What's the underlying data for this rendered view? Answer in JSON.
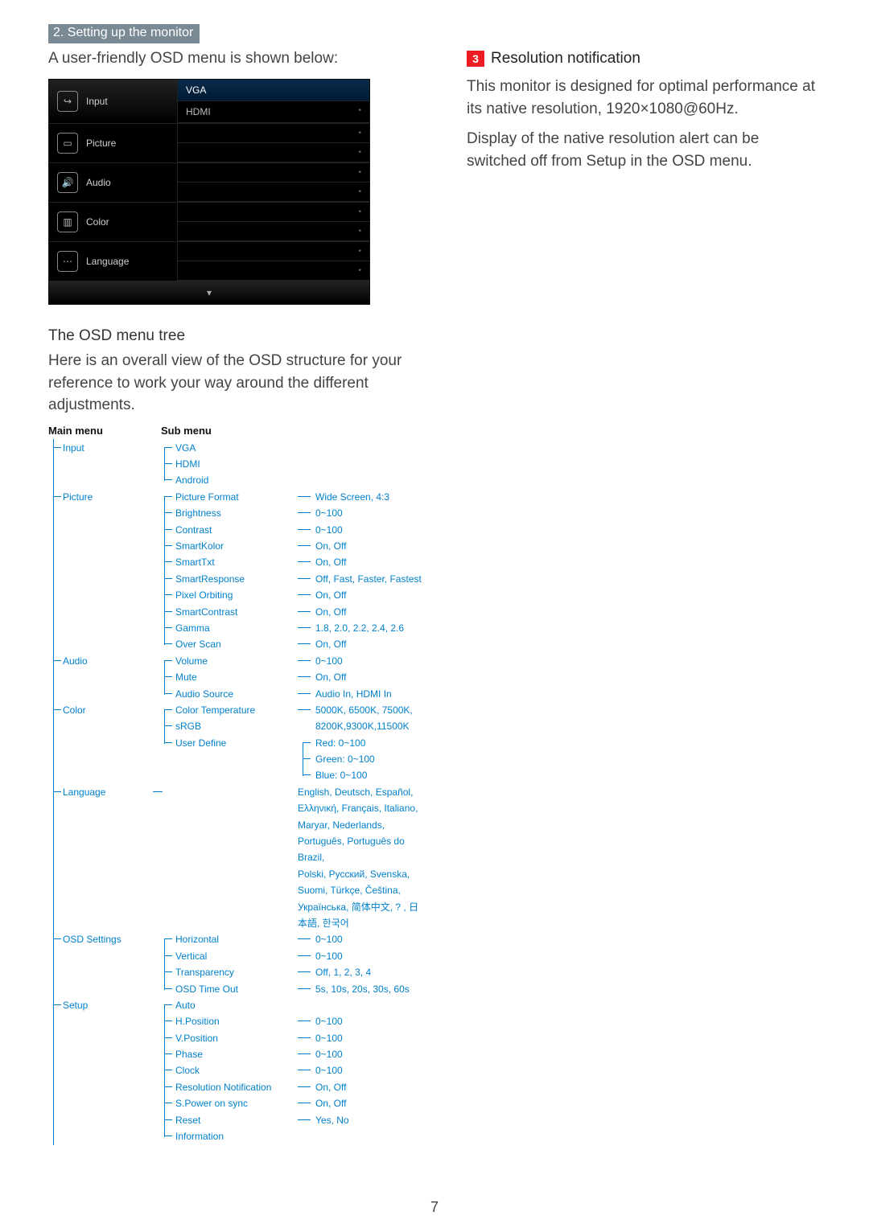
{
  "section_header": "2. Setting up the monitor",
  "left": {
    "intro": "A user-friendly OSD menu is shown below:",
    "osd_menu": {
      "items": [
        {
          "icon": "↪",
          "label": "Input"
        },
        {
          "icon": "▭",
          "label": "Picture"
        },
        {
          "icon": "🔊",
          "label": "Audio"
        },
        {
          "icon": "▥",
          "label": "Color"
        },
        {
          "icon": "⋯",
          "label": "Language"
        }
      ],
      "right_top": {
        "label": "VGA",
        "value": ""
      },
      "right_sub": {
        "label": "HDMI",
        "value": "•"
      },
      "placeholder_rows": [
        "•",
        "•",
        "•",
        "•",
        "•",
        "•",
        "•",
        "•"
      ],
      "bottom_arrow": "▾"
    },
    "tree_heading": "The OSD menu tree",
    "tree_intro": "Here is an overall view of the OSD structure for your reference to work your way around the different adjustments.",
    "tree_col_headers": {
      "main": "Main menu",
      "sub": "Sub menu"
    },
    "tree": {
      "Input": {
        "items": [
          {
            "label": "VGA"
          },
          {
            "label": "HDMI"
          },
          {
            "label": "Android"
          }
        ]
      },
      "Picture": {
        "items": [
          {
            "label": "Picture Format",
            "opts": "Wide Screen, 4:3"
          },
          {
            "label": "Brightness",
            "opts": "0~100"
          },
          {
            "label": "Contrast",
            "opts": "0~100"
          },
          {
            "label": "SmartKolor",
            "opts": "On, Off"
          },
          {
            "label": "SmartTxt",
            "opts": "On, Off"
          },
          {
            "label": "SmartResponse",
            "opts": "Off, Fast, Faster, Fastest"
          },
          {
            "label": "Pixel Orbiting",
            "opts": "On, Off"
          },
          {
            "label": "SmartContrast",
            "opts": "On, Off"
          },
          {
            "label": "Gamma",
            "opts": "1.8, 2.0, 2.2, 2.4, 2.6"
          },
          {
            "label": "Over Scan",
            "opts": "On, Off"
          }
        ]
      },
      "Audio": {
        "items": [
          {
            "label": "Volume",
            "opts": "0~100"
          },
          {
            "label": "Mute",
            "opts": "On, Off"
          },
          {
            "label": "Audio Source",
            "opts": "Audio In, HDMI In"
          }
        ]
      },
      "Color": {
        "items": [
          {
            "label": "Color Temperature",
            "opts": "5000K, 6500K, 7500K,"
          },
          {
            "label": "sRGB",
            "opts_cont": "8200K,9300K,11500K"
          },
          {
            "label": "User Define",
            "sub": [
              "Red: 0~100",
              "Green: 0~100",
              "Blue: 0~100"
            ]
          }
        ]
      },
      "Language": {
        "lines": [
          "English, Deutsch, Español, Ελληνική, Français, Italiano,",
          "Maryar, Nederlands, Português, Português do Brazil,",
          "Polski, Русский, Svenska, Suomi, Türkçe, Čeština,",
          "Українська, 简体中文, ?       , 日本語, 한국어"
        ]
      },
      "OSD Settings": {
        "items": [
          {
            "label": "Horizontal",
            "opts": "0~100"
          },
          {
            "label": "Vertical",
            "opts": "0~100"
          },
          {
            "label": "Transparency",
            "opts": "Off, 1, 2, 3, 4"
          },
          {
            "label": "OSD Time Out",
            "opts": "5s, 10s, 20s, 30s, 60s"
          }
        ]
      },
      "Setup": {
        "items": [
          {
            "label": "Auto"
          },
          {
            "label": "H.Position",
            "opts": "0~100"
          },
          {
            "label": "V.Position",
            "opts": "0~100"
          },
          {
            "label": "Phase",
            "opts": "0~100"
          },
          {
            "label": "Clock",
            "opts": "0~100"
          },
          {
            "label": "Resolution Notification",
            "opts": "On, Off"
          },
          {
            "label": "S.Power on sync",
            "opts": "On, Off"
          },
          {
            "label": "Reset",
            "opts": "Yes, No"
          },
          {
            "label": "Information"
          }
        ]
      }
    }
  },
  "right": {
    "step_num": "3",
    "heading": "Resolution notification",
    "p1": "This monitor is designed for optimal performance at its native resolution, 1920×1080@60Hz.",
    "p2": "Display of the native resolution alert can be switched off from Setup in the OSD menu."
  },
  "page_number": "7"
}
